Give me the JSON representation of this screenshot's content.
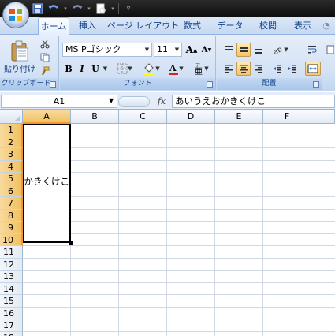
{
  "ribbon_tabs": [
    "ホーム",
    "挿入",
    "ページ レイアウト",
    "数式",
    "データ",
    "校閲",
    "表示"
  ],
  "clipboard": {
    "paste_label": "貼り付け",
    "group_label": "クリップボード"
  },
  "font": {
    "name": "MS Pゴシック",
    "size": "11",
    "group_label": "フォント"
  },
  "alignment": {
    "group_label": "配置"
  },
  "formula_bar": {
    "name_box": "A1",
    "fx_label": "fx",
    "content": "あいうえおかきくけこ"
  },
  "grid": {
    "columns": [
      "A",
      "B",
      "C",
      "D",
      "E",
      "F"
    ],
    "rows": [
      "1",
      "2",
      "3",
      "4",
      "5",
      "6",
      "7",
      "8",
      "9",
      "10",
      "11",
      "12",
      "13",
      "14",
      "15",
      "16",
      "17",
      "18"
    ],
    "selected_range": "A1:A10",
    "merged_cell_text": "あいうえおかきくけこ"
  },
  "colors": {
    "selected_header": "#f1c15f",
    "grid_line": "#d0d7e5",
    "ribbon_text": "#15428b"
  }
}
